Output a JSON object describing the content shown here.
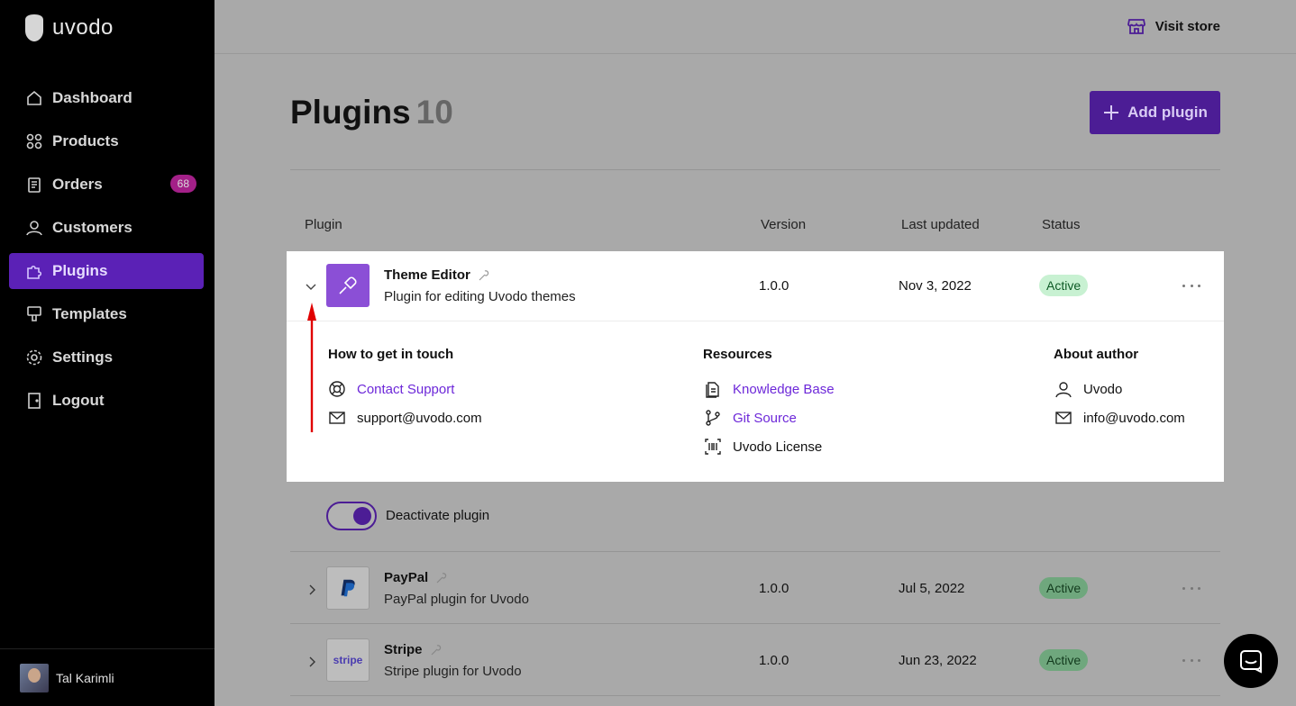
{
  "brand": {
    "name": "uvodo"
  },
  "sidebar": {
    "items": [
      {
        "label": "Dashboard",
        "icon": "home-icon"
      },
      {
        "label": "Products",
        "icon": "grid-icon"
      },
      {
        "label": "Orders",
        "icon": "clipboard-icon",
        "badge": "68"
      },
      {
        "label": "Customers",
        "icon": "user-icon"
      },
      {
        "label": "Plugins",
        "icon": "puzzle-icon",
        "active": true
      },
      {
        "label": "Templates",
        "icon": "brush-icon"
      },
      {
        "label": "Settings",
        "icon": "gear-icon"
      },
      {
        "label": "Logout",
        "icon": "door-icon"
      }
    ],
    "user": {
      "name": "Tal Karimli"
    }
  },
  "topbar": {
    "visit_store": "Visit store"
  },
  "page": {
    "title": "Plugins",
    "count": "10",
    "add_button": "Add plugin"
  },
  "table": {
    "headers": {
      "plugin": "Plugin",
      "version": "Version",
      "last_updated": "Last updated",
      "status": "Status"
    },
    "rows": [
      {
        "name": "Theme Editor",
        "description": "Plugin for editing Uvodo themes",
        "version": "1.0.0",
        "updated": "Nov 3, 2022",
        "status": "Active"
      },
      {
        "name": "PayPal",
        "description": "PayPal plugin for Uvodo",
        "version": "1.0.0",
        "updated": "Jul 5, 2022",
        "status": "Active"
      },
      {
        "name": "Stripe",
        "description": "Stripe plugin for Uvodo",
        "version": "1.0.0",
        "updated": "Jun 23, 2022",
        "status": "Active",
        "logo_text": "stripe"
      }
    ]
  },
  "details": {
    "contact": {
      "title": "How to get in touch",
      "support_link": "Contact Support",
      "email": "support@uvodo.com"
    },
    "resources": {
      "title": "Resources",
      "knowledge_base": "Knowledge Base",
      "git_source": "Git Source",
      "license": "Uvodo License"
    },
    "author": {
      "title": "About author",
      "name": "Uvodo",
      "email": "info@uvodo.com"
    }
  },
  "deactivate_label": "Deactivate plugin",
  "colors": {
    "accent": "#5b21b6",
    "link": "#6d28d9",
    "status_bg": "#c6f0d0",
    "badge": "#c026a0",
    "annotation_arrow": "#e00000"
  }
}
